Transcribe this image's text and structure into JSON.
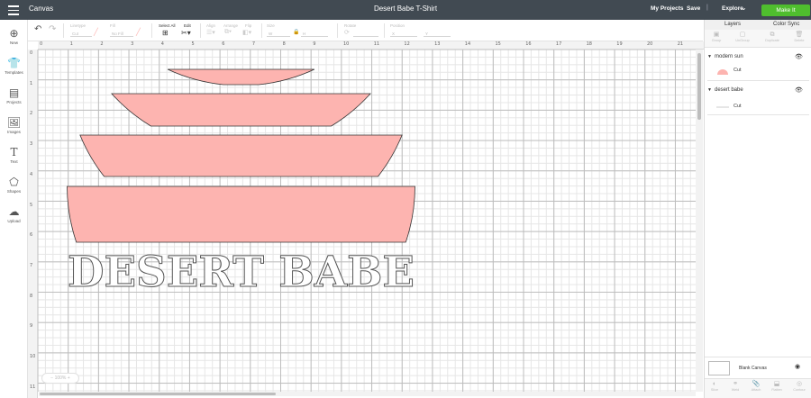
{
  "header": {
    "app_title": "Canvas",
    "document_title": "Desert Babe T-Shirt",
    "my_projects": "My Projects",
    "save": "Save",
    "separator": "|",
    "explore": "Explore",
    "make_it": "Make It",
    "accent_color": "#4fbe2e",
    "bar_color": "#414a52"
  },
  "toolbar": {
    "undo_icon": "undo-icon",
    "redo_icon": "redo-icon",
    "linetype_label": "Linetype",
    "linetype_value": "Cut",
    "fill_label": "Fill",
    "fill_value": "No Fill",
    "select_all_label": "Select All",
    "edit_label": "Edit",
    "align_label": "Align",
    "arrange_label": "Arrange",
    "flip_label": "Flip",
    "size_label": "Size",
    "size_w": "W",
    "size_h": "H",
    "rotate_label": "Rotate",
    "position_label": "Position",
    "position_x": "X",
    "position_y": "Y"
  },
  "sidebar": {
    "items": [
      {
        "label": "New",
        "icon": "plus-circle-icon"
      },
      {
        "label": "Templates",
        "icon": "shirt-icon"
      },
      {
        "label": "Projects",
        "icon": "projects-icon"
      },
      {
        "label": "Images",
        "icon": "image-icon"
      },
      {
        "label": "Text",
        "icon": "text-icon"
      },
      {
        "label": "Shapes",
        "icon": "shapes-icon"
      },
      {
        "label": "Upload",
        "icon": "upload-icon"
      }
    ]
  },
  "canvas": {
    "ruler_top": [
      "0",
      "1",
      "2",
      "3",
      "4",
      "5",
      "6",
      "7",
      "8",
      "9",
      "10",
      "11",
      "12",
      "13",
      "14",
      "15",
      "16",
      "17",
      "18",
      "19",
      "20",
      "21"
    ],
    "ruler_left": [
      "0",
      "1",
      "2",
      "3",
      "4",
      "5",
      "6",
      "7",
      "8",
      "9",
      "10",
      "11"
    ],
    "design_text": "DESERT BABE",
    "sun_color": "#fdb4b0",
    "zoom": "100%"
  },
  "layers_panel": {
    "tabs": [
      "Layers",
      "Color Sync"
    ],
    "actions": [
      "Group",
      "UnGroup",
      "Duplicate",
      "Delete"
    ],
    "groups": [
      {
        "name": "modern sun",
        "operation": "Cut",
        "swatch_color": "#fdb4b0"
      },
      {
        "name": "desert babe",
        "operation": "Cut",
        "swatch_color": "#ffffff"
      }
    ],
    "blank_canvas": "Blank Canvas",
    "bottom_actions": [
      "Slice",
      "Weld",
      "Attach",
      "Flatten",
      "Contour"
    ]
  }
}
